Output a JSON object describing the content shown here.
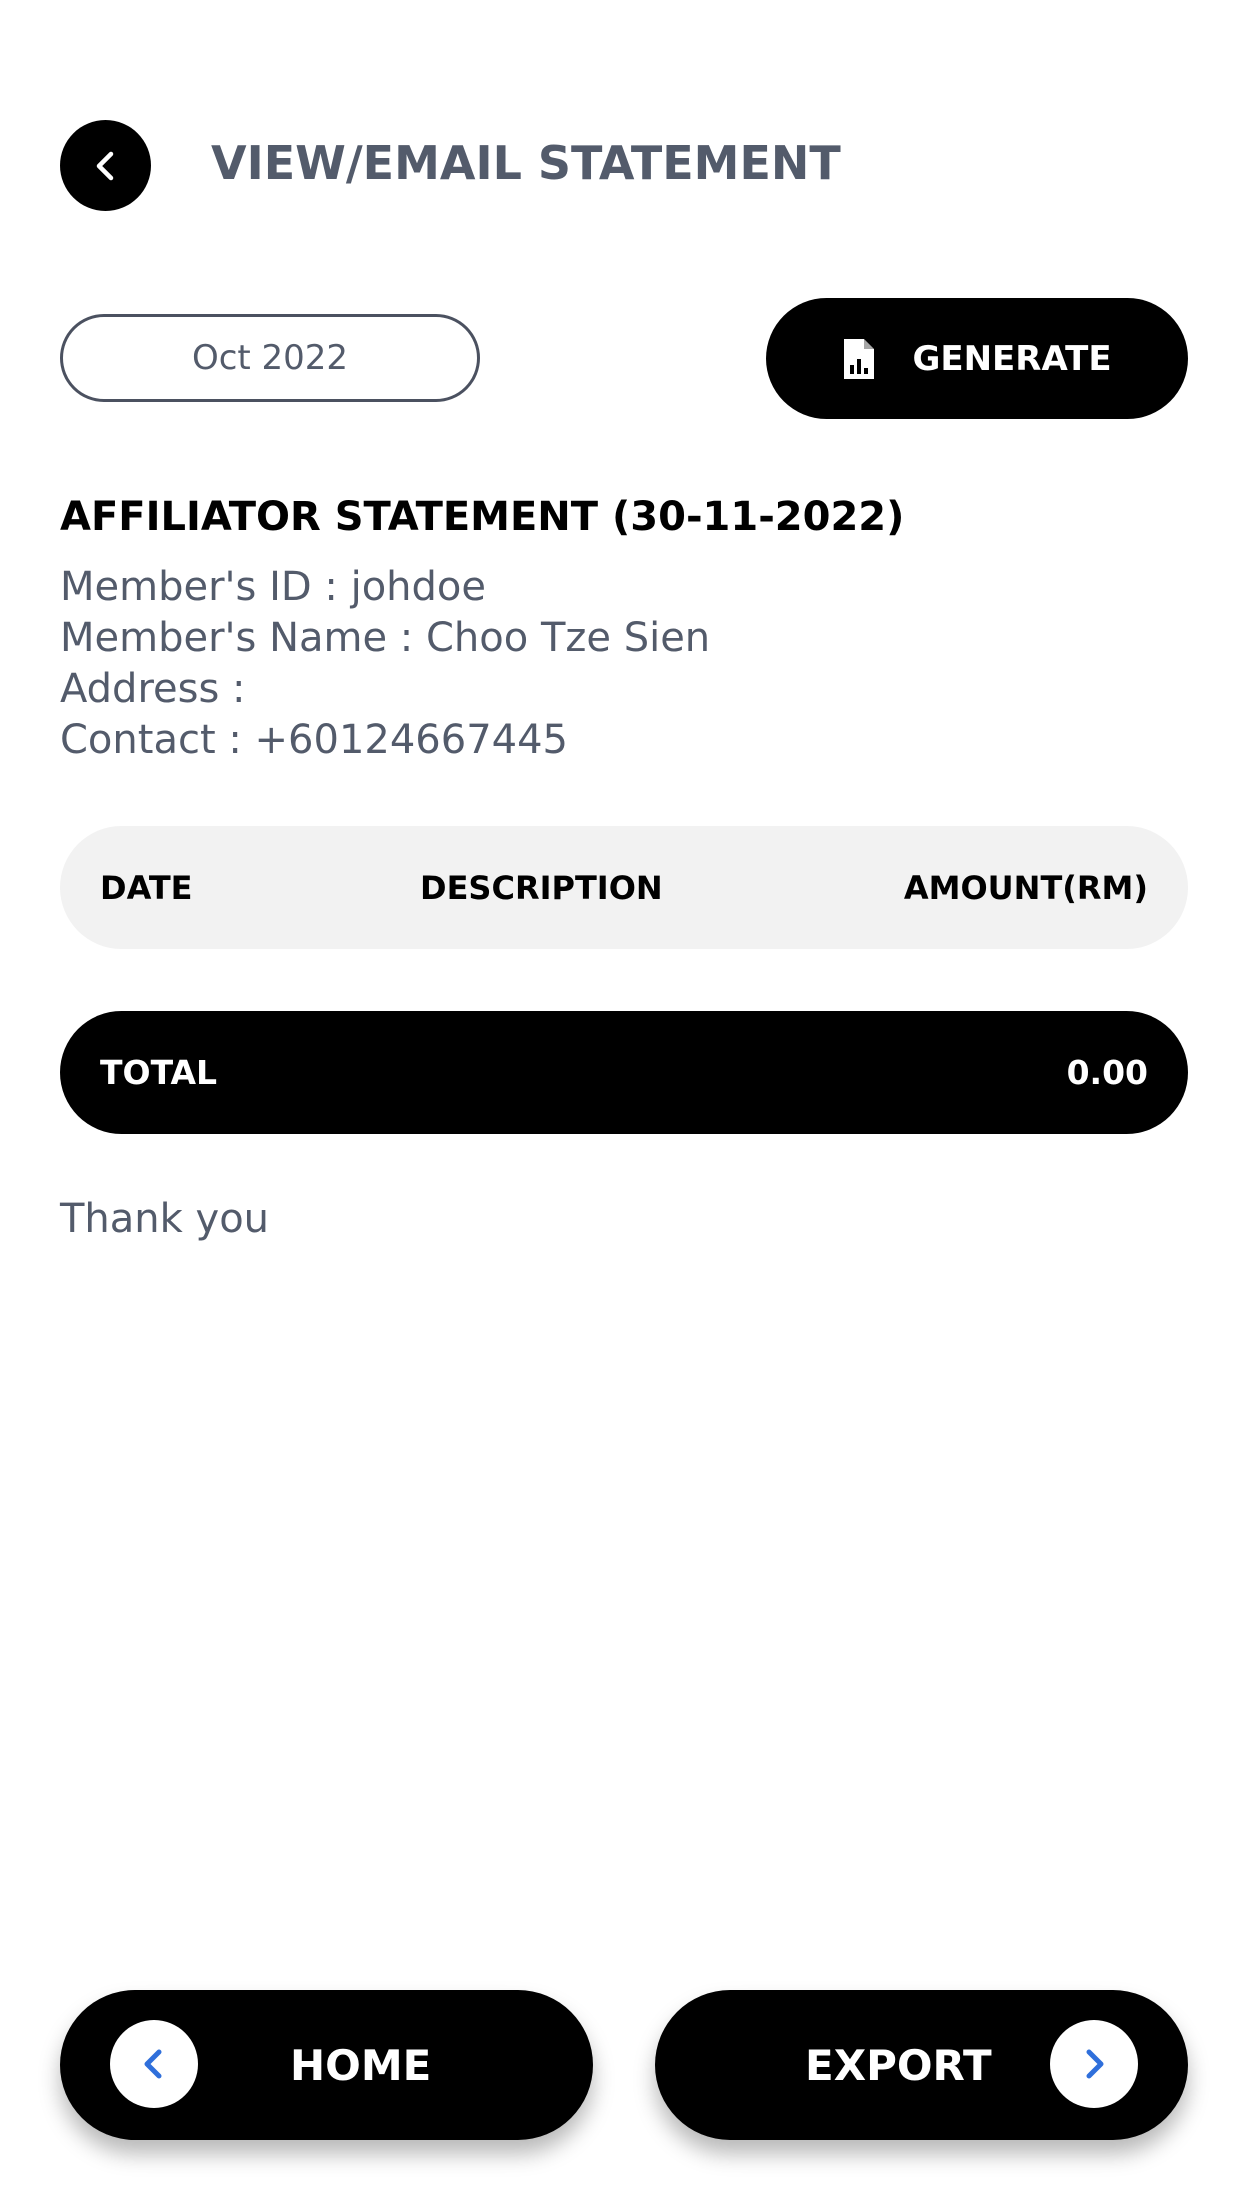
{
  "header": {
    "title": "VIEW/EMAIL STATEMENT",
    "back_icon": "chevron-left-icon"
  },
  "controls": {
    "month_value": "Oct 2022",
    "generate_label": "GENERATE",
    "generate_icon": "file-chart-icon"
  },
  "statement": {
    "title": "AFFILIATOR STATEMENT (30-11-2022)",
    "member_id": "Member's ID : johdoe",
    "member_name": "Member's Name : Choo Tze Sien",
    "address": "Address :",
    "contact": "Contact : +60124667445"
  },
  "table": {
    "columns": [
      "DATE",
      "DESCRIPTION",
      "AMOUNT(RM)"
    ],
    "rows": []
  },
  "total": {
    "label": "TOTAL",
    "value": "0.00"
  },
  "footer_note": "Thank you",
  "bottom_nav": {
    "home_label": "HOME",
    "export_label": "EXPORT",
    "accent_color": "#2f6fdb"
  }
}
